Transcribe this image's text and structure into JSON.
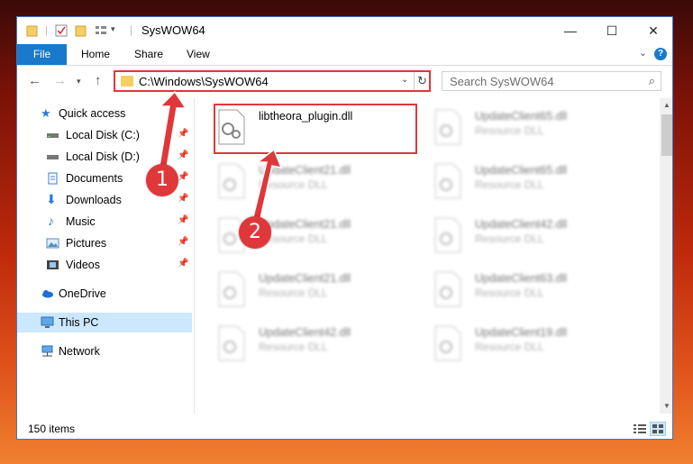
{
  "window": {
    "title": "SysWOW64",
    "controls": {
      "minimize": "—",
      "maximize": "☐",
      "close": "✕"
    }
  },
  "ribbon": {
    "file_tab": "File",
    "tabs": [
      "Home",
      "Share",
      "View"
    ],
    "help": "?"
  },
  "address_bar": {
    "path": "C:\\Windows\\SysWOW64"
  },
  "search": {
    "placeholder": "Search SysWOW64"
  },
  "sidebar": {
    "items": [
      {
        "label": "Quick access",
        "icon": "star-icon"
      },
      {
        "label": "Local Disk (C:)",
        "icon": "drive-icon",
        "pinned": true
      },
      {
        "label": "Local Disk (D:)",
        "icon": "drive-icon",
        "pinned": true
      },
      {
        "label": "Documents",
        "icon": "documents-icon",
        "pinned": true
      },
      {
        "label": "Downloads",
        "icon": "downloads-icon",
        "pinned": true
      },
      {
        "label": "Music",
        "icon": "music-icon",
        "pinned": true
      },
      {
        "label": "Pictures",
        "icon": "pictures-icon",
        "pinned": true
      },
      {
        "label": "Videos",
        "icon": "videos-icon",
        "pinned": true
      },
      {
        "label": "OneDrive",
        "icon": "cloud-icon"
      },
      {
        "label": "This PC",
        "icon": "computer-icon",
        "selected": true
      },
      {
        "label": "Network",
        "icon": "network-icon"
      }
    ]
  },
  "files": [
    {
      "name": "libtheora_plugin.dll",
      "type": ""
    },
    {
      "name": "UpdateClient65.dll",
      "type": "Resource DLL"
    },
    {
      "name": "UpdateClient21.dll",
      "type": "Resource DLL"
    },
    {
      "name": "UpdateClient65.dll",
      "type": "Resource DLL"
    },
    {
      "name": "UpdateClient21.dll",
      "type": "Resource DLL"
    },
    {
      "name": "UpdateClient42.dll",
      "type": "Resource DLL"
    },
    {
      "name": "UpdateClient21.dll",
      "type": "Resource DLL"
    },
    {
      "name": "UpdateClient63.dll",
      "type": "Resource DLL"
    },
    {
      "name": "UpdateClient42.dll",
      "type": "Resource DLL"
    },
    {
      "name": "UpdateClient19.dll",
      "type": "Resource DLL"
    }
  ],
  "status": {
    "item_count": "150 items"
  },
  "annotations": {
    "step1": "1",
    "step2": "2"
  },
  "colors": {
    "accent": "#1979ca",
    "highlight": "#e0373a",
    "selected": "#cce8ff"
  }
}
